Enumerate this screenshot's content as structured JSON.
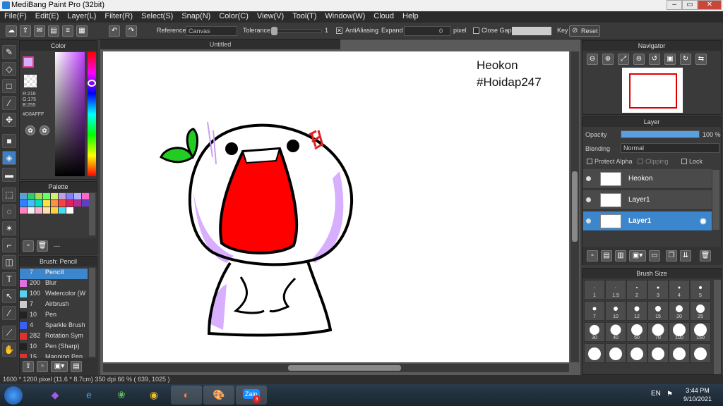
{
  "window": {
    "title": "MediBang Paint Pro (32bit)",
    "min": "–",
    "max": "▭",
    "close": "✕"
  },
  "menu": [
    "File(F)",
    "Edit(E)",
    "Layer(L)",
    "Filter(R)",
    "Select(S)",
    "Snap(N)",
    "Color(C)",
    "View(V)",
    "Tool(T)",
    "Window(W)",
    "Cloud",
    "Help"
  ],
  "toolbar": {
    "reference_label": "Reference",
    "reference_value": "Canvas",
    "tolerance_label": "Tolerance",
    "tolerance_value": "1",
    "antialiasing_label": "AntiAliasing",
    "expand_label": "Expand",
    "expand_value": "0",
    "expand_unit": "pixel",
    "close_gaps_label": "Close Gaps",
    "key_label": "Key",
    "reset_label": "Reset"
  },
  "color_panel": {
    "title": "Color",
    "r": "R:216",
    "g": "G:175",
    "b": "B:255",
    "hex": "#D8AFFF"
  },
  "palette_panel": {
    "title": "Palette",
    "dash": "---"
  },
  "brush_panel": {
    "title": "Brush: Pencil",
    "items": [
      {
        "size": "7",
        "name": "Pencil",
        "color": "#3b86cc"
      },
      {
        "size": "200",
        "name": "Blur",
        "color": "#e070e0"
      },
      {
        "size": "100",
        "name": "Watercolor (W",
        "color": "#5ad0f0"
      },
      {
        "size": "7",
        "name": "Airbrush",
        "color": "#cccccc"
      },
      {
        "size": "10",
        "name": "Pen",
        "color": "#222222"
      },
      {
        "size": "4",
        "name": "Sparkle Brush",
        "color": "#3b5ff0"
      },
      {
        "size": "282",
        "name": "Rotation Sym",
        "color": "#e03030"
      },
      {
        "size": "10",
        "name": "Pen (Sharp)",
        "color": "#222222"
      },
      {
        "size": "15",
        "name": "Mapping Pen",
        "color": "#e03030"
      }
    ]
  },
  "canvas": {
    "tab": "Untitled",
    "watermark_line1": "Heokon",
    "watermark_line2": "#Hoidap247"
  },
  "navigator": {
    "title": "Navigator"
  },
  "layer_panel": {
    "title": "Layer",
    "opacity_label": "Opacity",
    "opacity_value": "100 %",
    "opacity_fraction": 1.0,
    "blending_label": "Blending",
    "blending_value": "Normal",
    "protect_alpha": "Protect Alpha",
    "clipping": "Clipping",
    "lock": "Lock",
    "layers": [
      {
        "name": "Heokon",
        "selected": false
      },
      {
        "name": "Layer1",
        "selected": false
      },
      {
        "name": "Layer1",
        "selected": true
      }
    ]
  },
  "brush_size_panel": {
    "title": "Brush Size",
    "sizes": [
      "1",
      "1.5",
      "2",
      "3",
      "4",
      "5",
      "7",
      "10",
      "12",
      "15",
      "20",
      "25",
      "30",
      "40",
      "50",
      "70",
      "100",
      "150",
      "",
      "",
      "",
      "",
      "",
      ""
    ]
  },
  "status": {
    "text": "1600 * 1200 pixel  (11.6 * 8.7cm)  350 dpi  66 %  ( 639, 1025 )"
  },
  "taskbar": {
    "lang": "EN",
    "time": "3:44 PM",
    "date": "9/10/2021",
    "zalo_badge": "3",
    "zalo": "Zalo"
  }
}
